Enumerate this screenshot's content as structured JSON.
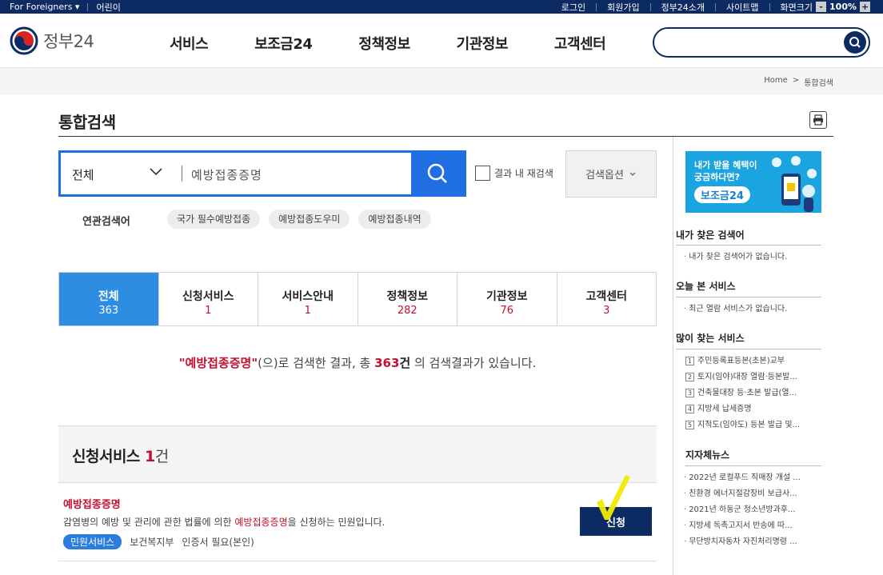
{
  "topbar": {
    "foreigners": "For Foreigners ▾",
    "kids": "어린이",
    "login": "로그인",
    "join": "회원가입",
    "intro": "정부24소개",
    "sitemap": "사이트맵",
    "zoom_label": "화면크기",
    "zoom_value": "100%",
    "zoom_minus": "-",
    "zoom_plus": "+"
  },
  "header": {
    "logo_text": "정부24",
    "nav": [
      "서비스",
      "보조금24",
      "정책정보",
      "기관정보",
      "고객센터"
    ],
    "search_placeholder": ""
  },
  "breadcrumb": {
    "home": "Home",
    "sep": ">",
    "current": "통합검색"
  },
  "page_title": "통합검색",
  "search": {
    "category": "전체",
    "query": "예방접종증명",
    "recheck_label": "결과 내 재검색",
    "options_label": "검색옵션"
  },
  "related": {
    "label": "연관검색어",
    "chips": [
      "국가 필수예방접종",
      "예방접종도우미",
      "예방접종내역"
    ]
  },
  "tabs": [
    {
      "label": "전체",
      "count": "363"
    },
    {
      "label": "신청서비스",
      "count": "1"
    },
    {
      "label": "서비스안내",
      "count": "1"
    },
    {
      "label": "정책정보",
      "count": "282"
    },
    {
      "label": "기관정보",
      "count": "76"
    },
    {
      "label": "고객센터",
      "count": "3"
    }
  ],
  "result": {
    "keyword": "\"예방접종증명\"",
    "mid": "(으)로 검색한 결과, 총 ",
    "count": "363",
    "unit": "건",
    "tail": " 의 검색결과가 있습니다."
  },
  "section": {
    "title": "신청서비스 ",
    "count": "1",
    "unit": "건"
  },
  "item": {
    "title": "예방접종증명",
    "desc_pre": "감염병의 예방 및 관리에 관한 법률에 의한 ",
    "desc_hl": "예방접종증명",
    "desc_post": "을 신청하는 민원입니다.",
    "badge": "민원서비스",
    "org": "보건복지부",
    "cert": "인증서 필요(본인)",
    "apply": "신청"
  },
  "sidebar": {
    "banner_line1": "내가 받을 혜택이",
    "banner_line2": "궁금하다면?",
    "banner_pill": "보조금24",
    "recent_search_title": "내가 찾은 검색어",
    "recent_search_empty": "내가 찾은 검색어가 없습니다.",
    "today_title": "오늘 본 서비스",
    "today_empty": "최근 열람 서비스가 없습니다.",
    "popular_title": "많이 찾는 서비스",
    "popular": [
      "주민등록표등본(초본)교부",
      "토지(임야)대장 열람·등본발...",
      "건축물대장 등·초본 발급(열...",
      "지방세 납세증명",
      "지적도(임야도) 등본 발급 및..."
    ],
    "news_title": "지자체뉴스",
    "news": [
      "2022년 로컬푸드 직매장 개설 ...",
      "친환경 에너지절감장비 보급사...",
      "2021년 하동군 청소년방과후...",
      "지방세 독촉고지서 반송에 따...",
      "무단방치자동차 자진처리명령 ..."
    ]
  },
  "colors": {
    "navy": "#0d2b63",
    "blue": "#1f6fe3",
    "tab_active": "#2d8de3",
    "red": "#c3102f"
  }
}
